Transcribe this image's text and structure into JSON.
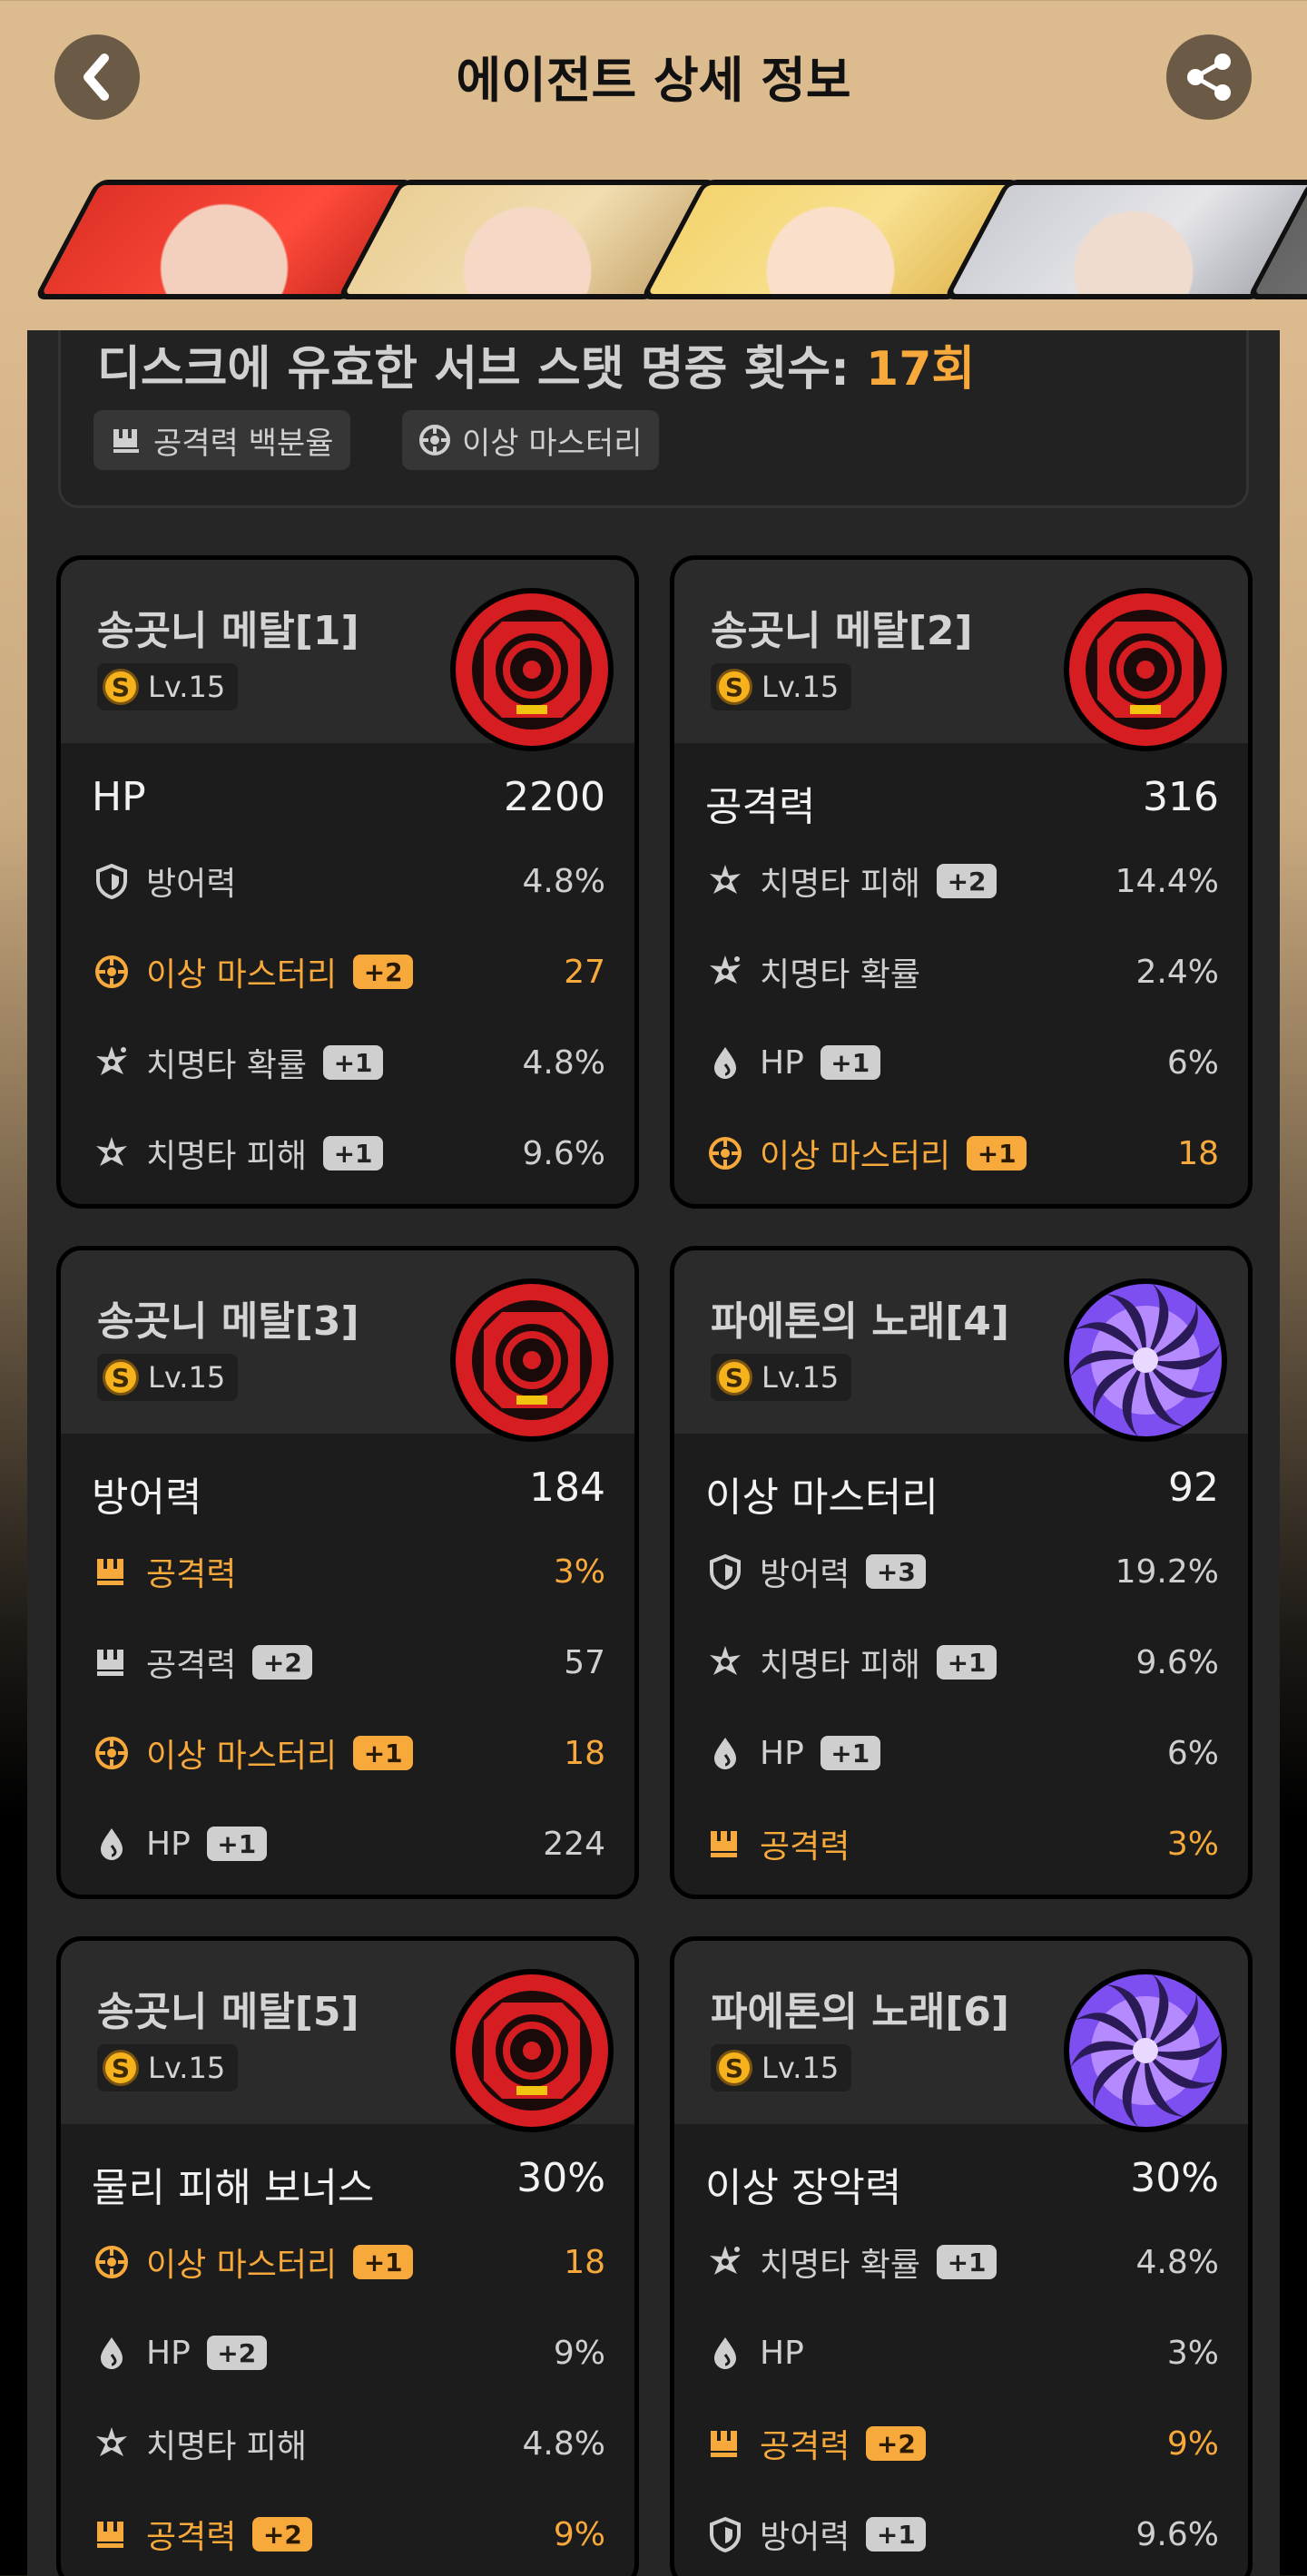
{
  "header": {
    "title": "에이전트 상세 정보",
    "back_icon": "chevron-left-icon",
    "share_icon": "share-icon"
  },
  "summary": {
    "label": "디스크에 유효한 서브 스탯 명중 횟수: ",
    "count": "17회",
    "tags": [
      "공격력 백분율",
      "이상 마스터리"
    ]
  },
  "discs": [
    {
      "name": "송곳니 메탈[1]",
      "level": "Lv.15",
      "main": {
        "name": "HP",
        "value": "2200"
      },
      "subs": [
        {
          "name": "방어력",
          "roll": "",
          "value": "4.8%",
          "hl": false,
          "icon": "shield-icon"
        },
        {
          "name": "이상 마스터리",
          "roll": "+2",
          "value": "27",
          "hl": true,
          "icon": "anomaly-icon"
        },
        {
          "name": "치명타 확률",
          "roll": "+1",
          "value": "4.8%",
          "hl": false,
          "icon": "crit-rate-icon"
        },
        {
          "name": "치명타 피해",
          "roll": "+1",
          "value": "9.6%",
          "hl": false,
          "icon": "crit-dmg-icon"
        }
      ]
    },
    {
      "name": "송곳니 메탈[2]",
      "level": "Lv.15",
      "main": {
        "name": "공격력",
        "value": "316"
      },
      "subs": [
        {
          "name": "치명타 피해",
          "roll": "+2",
          "value": "14.4%",
          "hl": false,
          "icon": "crit-dmg-icon"
        },
        {
          "name": "치명타 확률",
          "roll": "",
          "value": "2.4%",
          "hl": false,
          "icon": "crit-rate-icon"
        },
        {
          "name": "HP",
          "roll": "+1",
          "value": "6%",
          "hl": false,
          "icon": "hp-icon"
        },
        {
          "name": "이상 마스터리",
          "roll": "+1",
          "value": "18",
          "hl": true,
          "icon": "anomaly-icon"
        }
      ]
    },
    {
      "name": "송곳니 메탈[3]",
      "level": "Lv.15",
      "main": {
        "name": "방어력",
        "value": "184"
      },
      "subs": [
        {
          "name": "공격력",
          "roll": "",
          "value": "3%",
          "hl": true,
          "icon": "atk-icon"
        },
        {
          "name": "공격력",
          "roll": "+2",
          "value": "57",
          "hl": false,
          "icon": "atk-icon"
        },
        {
          "name": "이상 마스터리",
          "roll": "+1",
          "value": "18",
          "hl": true,
          "icon": "anomaly-icon"
        },
        {
          "name": "HP",
          "roll": "+1",
          "value": "224",
          "hl": false,
          "icon": "hp-icon"
        }
      ]
    },
    {
      "name": "파에톤의 노래[4]",
      "level": "Lv.15",
      "main": {
        "name": "이상 마스터리",
        "value": "92"
      },
      "subs": [
        {
          "name": "방어력",
          "roll": "+3",
          "value": "19.2%",
          "hl": false,
          "icon": "shield-icon"
        },
        {
          "name": "치명타 피해",
          "roll": "+1",
          "value": "9.6%",
          "hl": false,
          "icon": "crit-dmg-icon"
        },
        {
          "name": "HP",
          "roll": "+1",
          "value": "6%",
          "hl": false,
          "icon": "hp-icon"
        },
        {
          "name": "공격력",
          "roll": "",
          "value": "3%",
          "hl": true,
          "icon": "atk-icon"
        }
      ]
    },
    {
      "name": "송곳니 메탈[5]",
      "level": "Lv.15",
      "main": {
        "name": "물리 피해 보너스",
        "value": "30%"
      },
      "subs": [
        {
          "name": "이상 마스터리",
          "roll": "+1",
          "value": "18",
          "hl": true,
          "icon": "anomaly-icon"
        },
        {
          "name": "HP",
          "roll": "+2",
          "value": "9%",
          "hl": false,
          "icon": "hp-icon"
        },
        {
          "name": "치명타 피해",
          "roll": "",
          "value": "4.8%",
          "hl": false,
          "icon": "crit-dmg-icon"
        },
        {
          "name": "공격력",
          "roll": "+2",
          "value": "9%",
          "hl": true,
          "icon": "atk-icon"
        }
      ]
    },
    {
      "name": "파에톤의 노래[6]",
      "level": "Lv.15",
      "main": {
        "name": "이상 장악력",
        "value": "30%"
      },
      "subs": [
        {
          "name": "치명타 확률",
          "roll": "+1",
          "value": "4.8%",
          "hl": false,
          "icon": "crit-rate-icon"
        },
        {
          "name": "HP",
          "roll": "",
          "value": "3%",
          "hl": false,
          "icon": "hp-icon"
        },
        {
          "name": "공격력",
          "roll": "+2",
          "value": "9%",
          "hl": true,
          "icon": "atk-icon"
        },
        {
          "name": "방어력",
          "roll": "+1",
          "value": "9.6%",
          "hl": false,
          "icon": "shield-icon"
        }
      ]
    }
  ],
  "colors": {
    "accent": "#f7a93b",
    "selected_border": "#ffe93a",
    "panel": "#262626",
    "card": "#1c1c1c"
  }
}
